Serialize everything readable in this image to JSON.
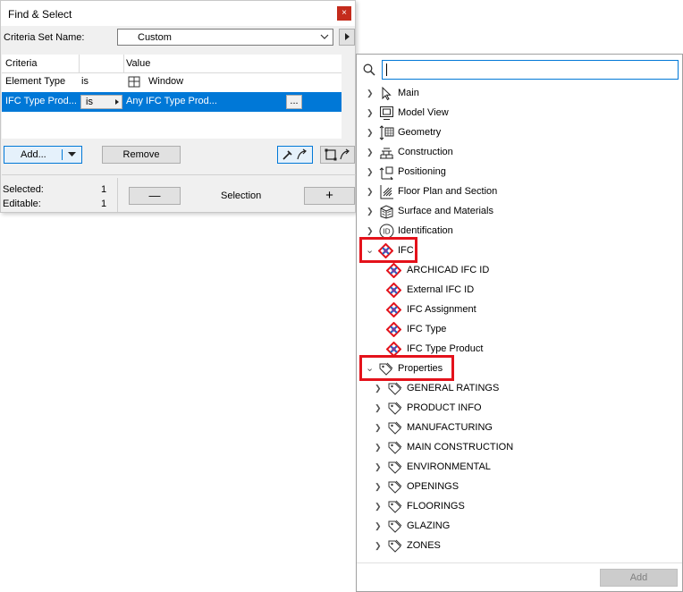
{
  "dialog": {
    "title": "Find & Select",
    "close_label": "×",
    "criteria_set_label": "Criteria Set Name:",
    "criteria_set_value": "Custom",
    "columns": [
      "Criteria",
      "Value"
    ],
    "rows": [
      {
        "criteria": "Element Type",
        "op": "is",
        "value": "Window"
      },
      {
        "criteria": "IFC Type Prod...",
        "op": "is",
        "value": "Any IFC Type Prod...",
        "more": "..."
      }
    ],
    "add_label": "Add...",
    "remove_label": "Remove",
    "selected_label": "Selected:",
    "selected_count": "1",
    "editable_label": "Editable:",
    "editable_count": "1",
    "minus_label": "—",
    "plus_label": "+",
    "selection_label": "Selection"
  },
  "panel": {
    "search_placeholder": "",
    "items": [
      {
        "label": "Main",
        "icon": "cursor-icon",
        "state": "collapsed"
      },
      {
        "label": "Model View",
        "icon": "model-view-icon",
        "state": "collapsed"
      },
      {
        "label": "Geometry",
        "icon": "geometry-icon",
        "state": "collapsed"
      },
      {
        "label": "Construction",
        "icon": "construction-icon",
        "state": "collapsed"
      },
      {
        "label": "Positioning",
        "icon": "positioning-icon",
        "state": "collapsed"
      },
      {
        "label": "Floor Plan and Section",
        "icon": "floor-plan-icon",
        "state": "collapsed"
      },
      {
        "label": "Surface and Materials",
        "icon": "surface-icon",
        "state": "collapsed"
      },
      {
        "label": "Identification",
        "icon": "id-icon",
        "state": "collapsed"
      },
      {
        "label": "IFC",
        "icon": "ifc-icon",
        "state": "expanded"
      }
    ],
    "ifc_children": [
      {
        "label": "ARCHICAD IFC ID"
      },
      {
        "label": "External IFC ID"
      },
      {
        "label": "IFC Assignment"
      },
      {
        "label": "IFC Type"
      },
      {
        "label": "IFC Type Product"
      }
    ],
    "properties_label": "Properties",
    "property_children": [
      {
        "label": "GENERAL RATINGS"
      },
      {
        "label": "PRODUCT INFO"
      },
      {
        "label": "MANUFACTURING"
      },
      {
        "label": "MAIN CONSTRUCTION"
      },
      {
        "label": "ENVIRONMENTAL"
      },
      {
        "label": "OPENINGS"
      },
      {
        "label": "FLOORINGS"
      },
      {
        "label": "GLAZING"
      },
      {
        "label": "ZONES"
      }
    ],
    "add_label": "Add"
  },
  "colors": {
    "accent": "#0078d7",
    "highlight": "#e4121b"
  }
}
